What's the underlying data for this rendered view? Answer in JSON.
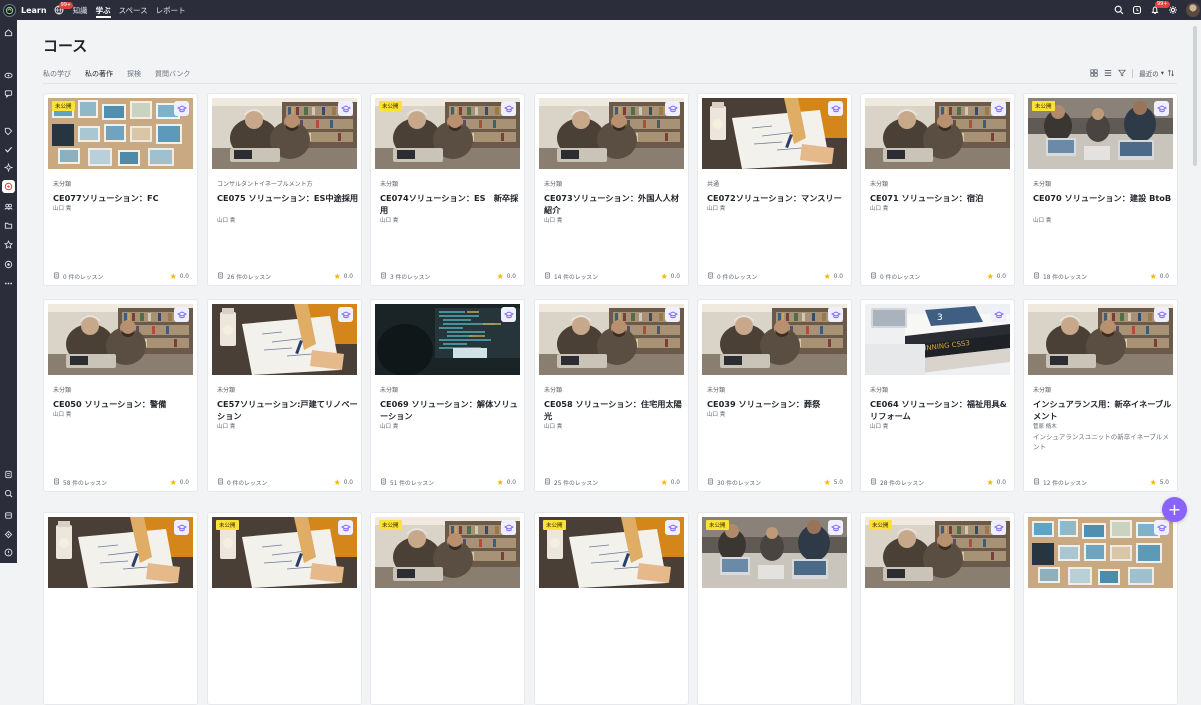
{
  "topbar": {
    "brand": "Learn",
    "globe_badge": "99+",
    "nav": [
      "知識",
      "学ぶ",
      "スペース",
      "レポート"
    ],
    "active_nav": "学ぶ",
    "bell_badge": "99+"
  },
  "page": {
    "title": "コース",
    "tabs": [
      "私の学び",
      "私の著作",
      "探検",
      "質問バンク"
    ],
    "active_tab": "私の著作",
    "sort_label": "最近の"
  },
  "cards": [
    {
      "unpublished": "未公開",
      "thumb": "photos",
      "category": "未分類",
      "title": "CE077ソリューション：FC",
      "author": "山口 貴",
      "lessons": "0 件のレッスン",
      "rating": "0.0"
    },
    {
      "unpublished": "",
      "thumb": "office",
      "category": "コンサルタントイネーブルメント方",
      "title": "CE075 ソリューション：ES中途採用",
      "author": "山口 貴",
      "lessons": "26 件のレッスン",
      "rating": "0.0"
    },
    {
      "unpublished": "未公開",
      "thumb": "office",
      "category": "未分類",
      "title": "CE074ソリューション：ES　新卒採用",
      "author": "山口 貴",
      "lessons": "3 件のレッスン",
      "rating": "0.0"
    },
    {
      "unpublished": "",
      "thumb": "office",
      "category": "未分類",
      "title": "CE073ソリューション：外国人人材紹介",
      "author": "山口 貴",
      "lessons": "14 件のレッスン",
      "rating": "0.0"
    },
    {
      "unpublished": "",
      "thumb": "writing",
      "category": "共通",
      "title": "CE072ソリューション：マンスリー",
      "author": "山口 貴",
      "lessons": "0 件のレッスン",
      "rating": "0.0"
    },
    {
      "unpublished": "",
      "thumb": "office",
      "category": "未分類",
      "title": "CE071 ソリューション：宿泊",
      "author": "山口 貴",
      "lessons": "0 件のレッスン",
      "rating": "0.0"
    },
    {
      "unpublished": "未公開",
      "thumb": "laptop",
      "category": "未分類",
      "title": "CE070 ソリューション：建設 BtoB",
      "author": "山口 貴",
      "lessons": "18 件のレッスン",
      "rating": "0.0"
    },
    {
      "unpublished": "",
      "thumb": "office",
      "category": "未分類",
      "title": "CE050 ソリューション：警備",
      "author": "山口 貴",
      "lessons": "58 件のレッスン",
      "rating": "0.0"
    },
    {
      "unpublished": "",
      "thumb": "writing",
      "category": "未分類",
      "title": "CE57ソリューション:戸建てリノベーション",
      "author": "山口 貴",
      "lessons": "0 件のレッスン",
      "rating": "0.0"
    },
    {
      "unpublished": "",
      "thumb": "code",
      "category": "未分類",
      "title": "CE069 ソリューション：解体ソリューション",
      "author": "山口 貴",
      "lessons": "51 件のレッスン",
      "rating": "0.0"
    },
    {
      "unpublished": "",
      "thumb": "office",
      "category": "未分類",
      "title": "CE058 ソリューション：住宅用太陽光",
      "author": "山口 貴",
      "lessons": "25 件のレッスン",
      "rating": "0.0"
    },
    {
      "unpublished": "",
      "thumb": "office",
      "category": "未分類",
      "title": "CE039 ソリューション：葬祭",
      "author": "山口 貴",
      "lessons": "30 件のレッスン",
      "rating": "5.0"
    },
    {
      "unpublished": "",
      "thumb": "books",
      "category": "未分類",
      "title": "CE064 ソリューション：福祉用具&リフォーム",
      "author": "山口 貴",
      "lessons": "28 件のレッスン",
      "rating": "0.0"
    },
    {
      "unpublished": "",
      "thumb": "office",
      "category": "未分類",
      "title": "インシュアランス用：新卒イネーブルメント",
      "author": "菅原 脩木",
      "description": "インシュアランスユニットの新卒イネーブルメント",
      "lessons": "12 件のレッスン",
      "rating": "5.0"
    },
    {
      "unpublished": "",
      "thumb": "writing",
      "category": "",
      "title": "",
      "author": "",
      "lessons": "",
      "rating": ""
    },
    {
      "unpublished": "未公開",
      "thumb": "writing",
      "category": "",
      "title": "",
      "author": "",
      "lessons": "",
      "rating": ""
    },
    {
      "unpublished": "未公開",
      "thumb": "office",
      "category": "",
      "title": "",
      "author": "",
      "lessons": "",
      "rating": ""
    },
    {
      "unpublished": "未公開",
      "thumb": "writing",
      "category": "",
      "title": "",
      "author": "",
      "lessons": "",
      "rating": ""
    },
    {
      "unpublished": "未公開",
      "thumb": "laptop",
      "category": "",
      "title": "",
      "author": "",
      "lessons": "",
      "rating": ""
    },
    {
      "unpublished": "未公開",
      "thumb": "office",
      "category": "",
      "title": "",
      "author": "",
      "lessons": "",
      "rating": ""
    },
    {
      "unpublished": "",
      "thumb": "photos",
      "category": "",
      "title": "",
      "author": "",
      "lessons": "",
      "rating": ""
    }
  ],
  "icons": {
    "top_right": [
      "search-icon",
      "clock-icon",
      "bell-icon",
      "gear-icon",
      "avatar"
    ],
    "rail": [
      "home-icon",
      "eye-icon",
      "chat-icon",
      "tag-icon",
      "check-icon",
      "sparkle-icon",
      "learn-icon",
      "group-icon",
      "folder-icon",
      "star-icon",
      "target-icon",
      "more-icon",
      "doc-icon",
      "search-plus-icon",
      "box-icon",
      "settings-icon",
      "help-icon"
    ]
  },
  "colors": {
    "topbar": "#2b2d3a",
    "accent": "#8a63ff",
    "unpublished_badge": "#fbe236",
    "star": "#f5b400"
  }
}
